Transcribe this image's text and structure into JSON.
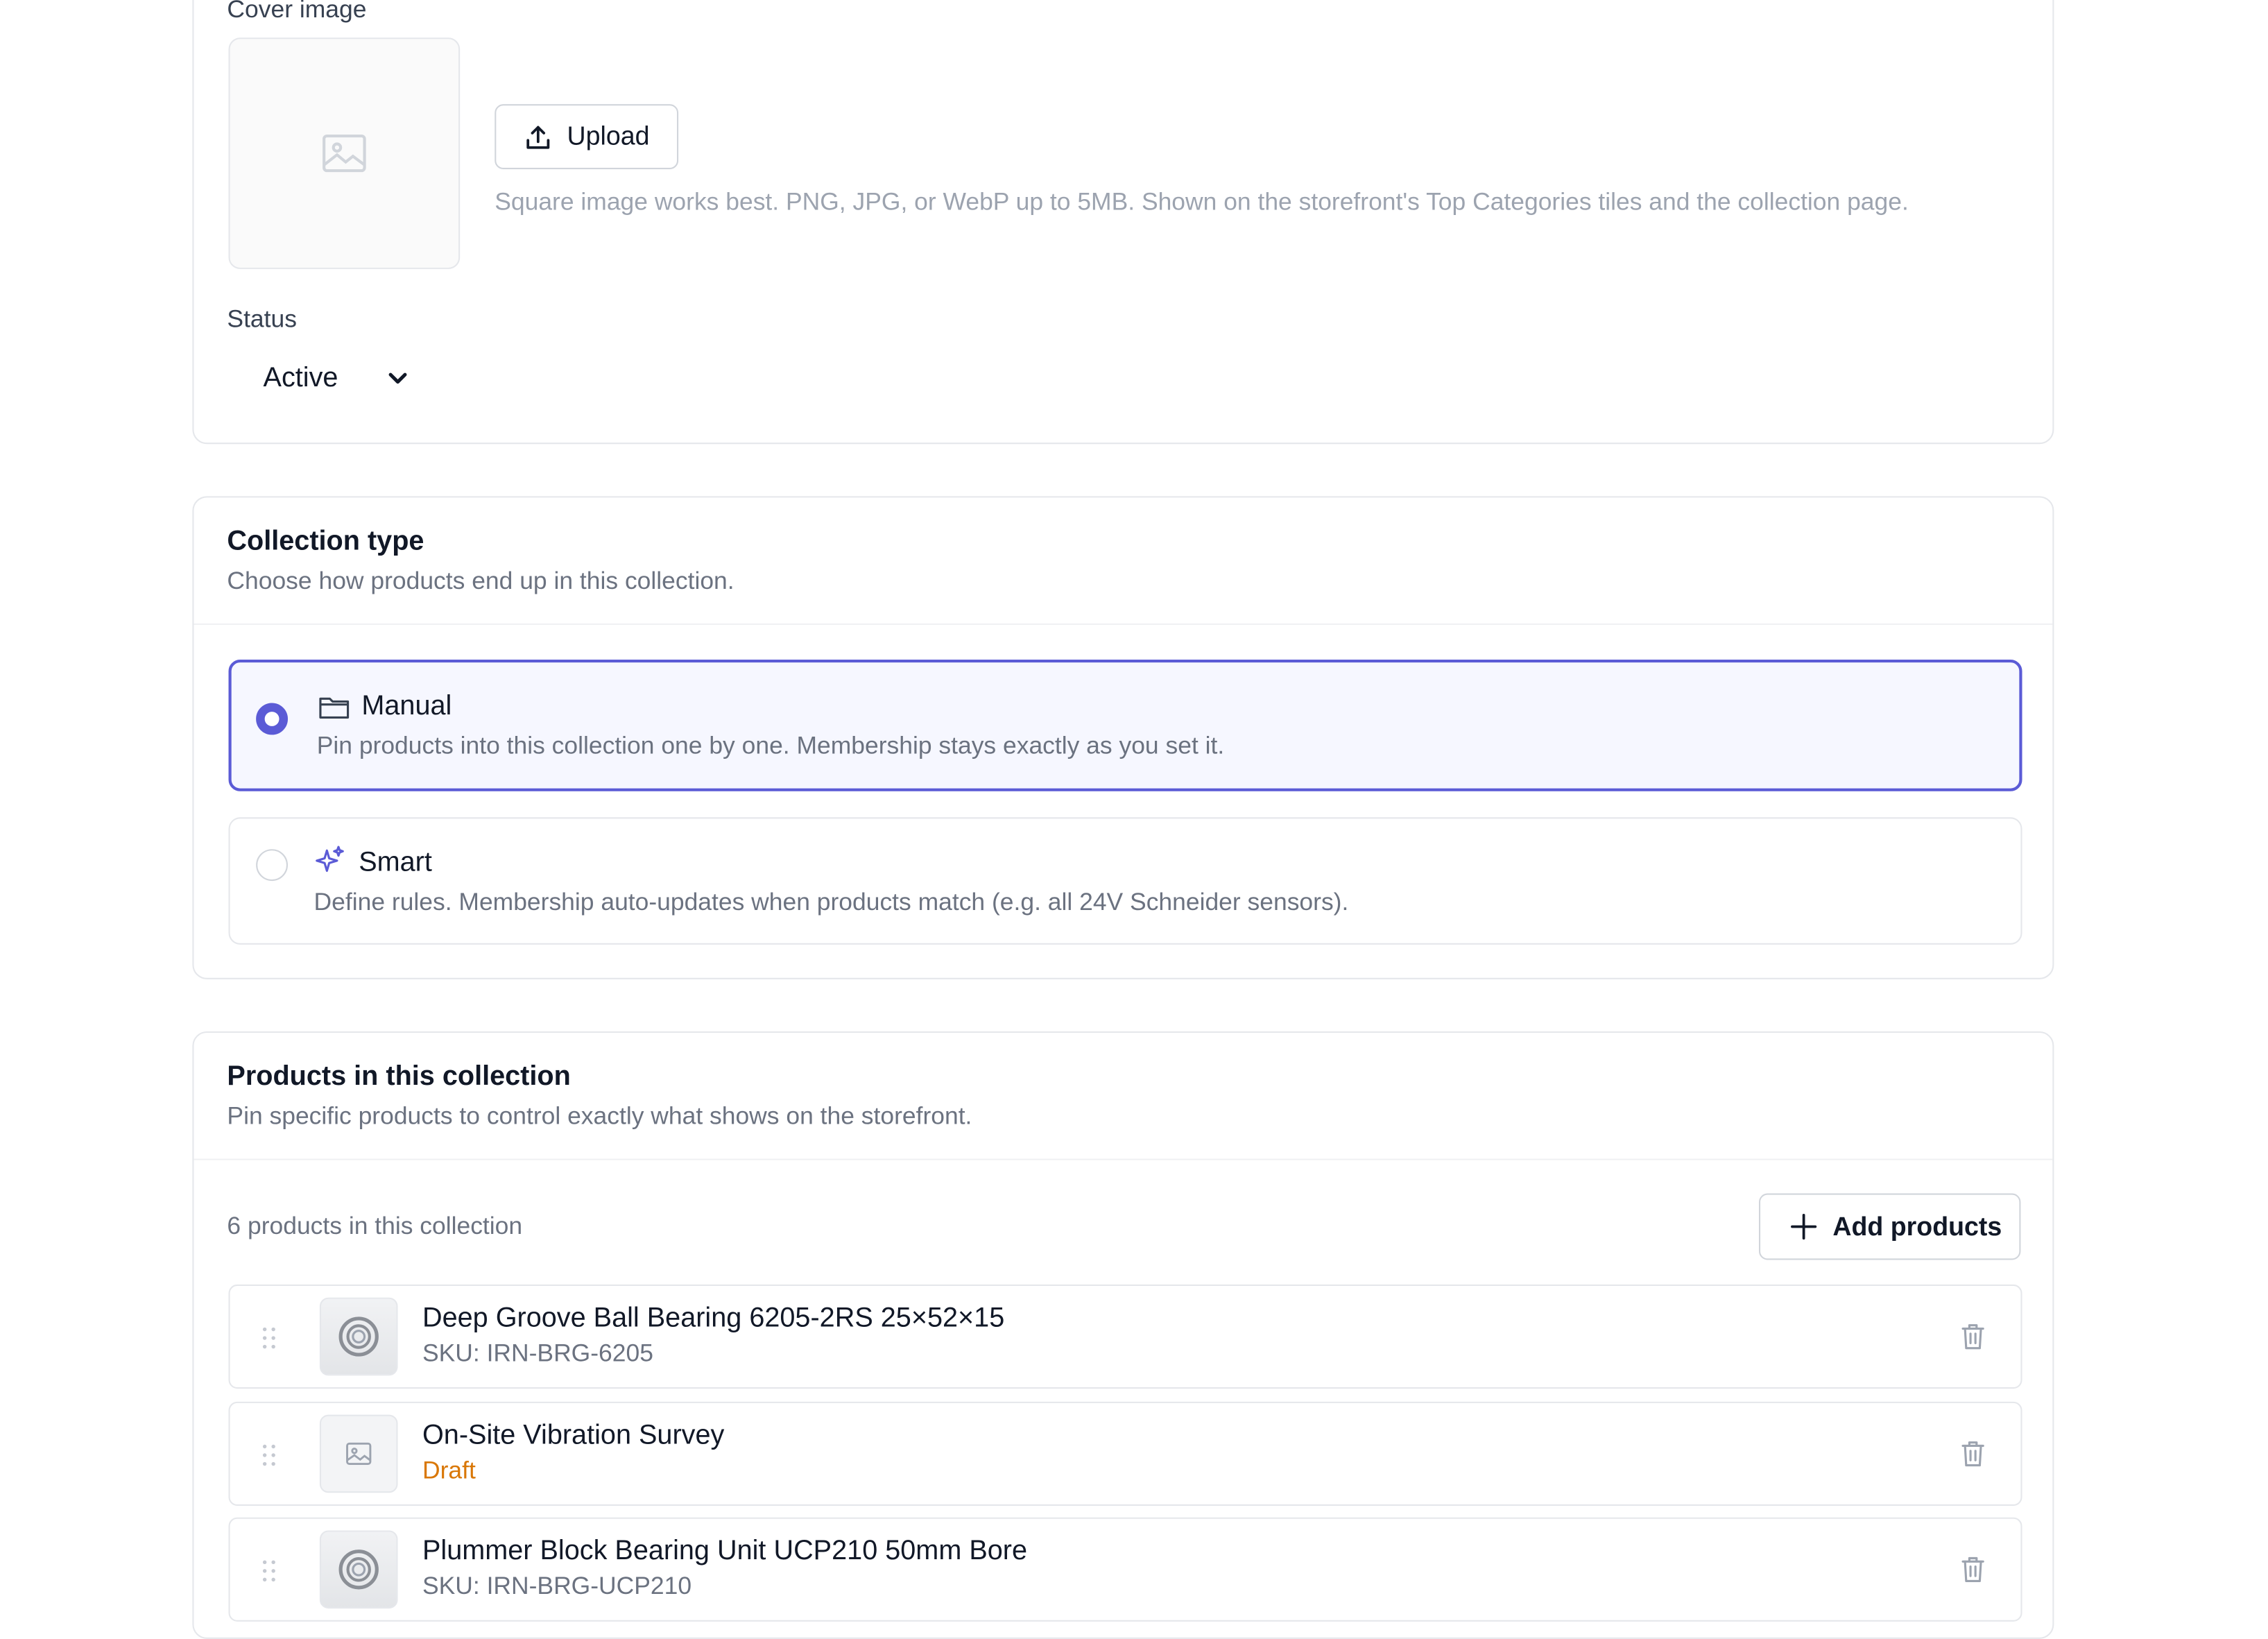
{
  "general": {
    "cover_image_label": "Cover image",
    "upload_label": "Upload",
    "upload_hint": "Square image works best. PNG, JPG, or WebP up to 5MB. Shown on the storefront's Top Categories tiles and the collection page.",
    "status_label": "Status",
    "status_value": "Active"
  },
  "collection_type": {
    "title": "Collection type",
    "subtitle": "Choose how products end up in this collection.",
    "options": [
      {
        "label": "Manual",
        "description": "Pin products into this collection one by one. Membership stays exactly as you set it.",
        "selected": true,
        "icon": "folder-icon"
      },
      {
        "label": "Smart",
        "description": "Define rules. Membership auto-updates when products match (e.g. all 24V Schneider sensors).",
        "selected": false,
        "icon": "sparkles-icon"
      }
    ]
  },
  "products": {
    "title": "Products in this collection",
    "subtitle": "Pin specific products to control exactly what shows on the storefront.",
    "count_text": "6 products in this collection",
    "add_button_label": "Add products",
    "items": [
      {
        "name": "Deep Groove Ball Bearing 6205-2RS 25×52×15",
        "meta": "SKU: IRN-BRG-6205",
        "thumb": "bearing-thumbnail"
      },
      {
        "name": "On-Site Vibration Survey",
        "meta": "Draft",
        "thumb": "image-placeholder-icon"
      },
      {
        "name": "Plummer Block Bearing Unit UCP210 50mm Bore",
        "meta": "SKU: IRN-BRG-UCP210",
        "thumb": "bearing-thumbnail"
      }
    ]
  },
  "colors": {
    "accent": "#5b5bd6",
    "selected_bg": "#f6f7ff",
    "draft": "#d97706",
    "border": "#e5e7eb"
  }
}
